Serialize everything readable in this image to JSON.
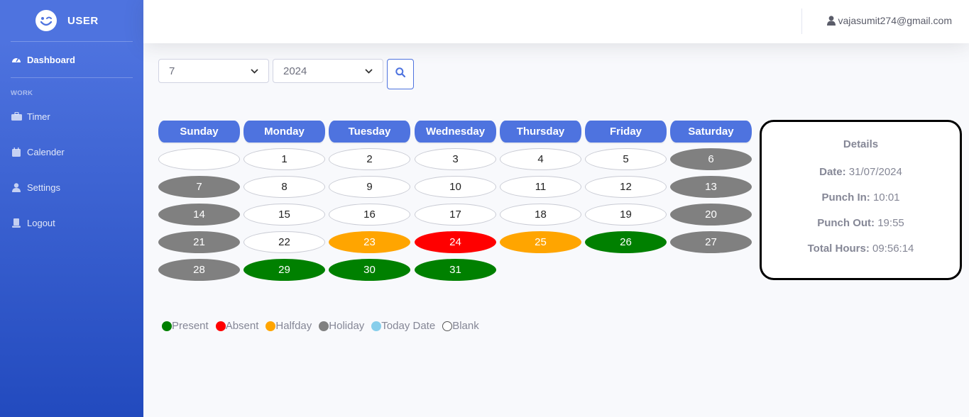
{
  "brand": {
    "name": "USER",
    "icon": "winking-face-icon"
  },
  "sidebar": {
    "active": {
      "label": "Dashboard",
      "icon": "gauge-icon"
    },
    "heading": "WORK",
    "items": [
      {
        "label": "Timer",
        "icon": "toolbox-icon"
      },
      {
        "label": "Calender",
        "icon": "calendar-icon"
      },
      {
        "label": "Settings",
        "icon": "user-icon"
      },
      {
        "label": "Logout",
        "icon": "logout-icon"
      }
    ]
  },
  "topbar": {
    "user_email": "vajasumit274@gmail.com",
    "user_icon": "user-icon"
  },
  "filters": {
    "month": "7",
    "year": "2024",
    "search_icon": "search-icon"
  },
  "calendar": {
    "weekdays": [
      "Sunday",
      "Monday",
      "Tuesday",
      "Wednesday",
      "Thursday",
      "Friday",
      "Saturday"
    ],
    "start_offset": 1,
    "days": [
      {
        "d": "1",
        "s": "blank"
      },
      {
        "d": "2",
        "s": "blank"
      },
      {
        "d": "3",
        "s": "blank"
      },
      {
        "d": "4",
        "s": "blank"
      },
      {
        "d": "5",
        "s": "blank"
      },
      {
        "d": "6",
        "s": "holiday"
      },
      {
        "d": "7",
        "s": "holiday"
      },
      {
        "d": "8",
        "s": "blank"
      },
      {
        "d": "9",
        "s": "blank"
      },
      {
        "d": "10",
        "s": "blank"
      },
      {
        "d": "11",
        "s": "blank"
      },
      {
        "d": "12",
        "s": "blank"
      },
      {
        "d": "13",
        "s": "holiday"
      },
      {
        "d": "14",
        "s": "holiday"
      },
      {
        "d": "15",
        "s": "blank"
      },
      {
        "d": "16",
        "s": "blank"
      },
      {
        "d": "17",
        "s": "blank"
      },
      {
        "d": "18",
        "s": "blank"
      },
      {
        "d": "19",
        "s": "blank"
      },
      {
        "d": "20",
        "s": "holiday"
      },
      {
        "d": "21",
        "s": "holiday"
      },
      {
        "d": "22",
        "s": "blank"
      },
      {
        "d": "23",
        "s": "halfday"
      },
      {
        "d": "24",
        "s": "absent"
      },
      {
        "d": "25",
        "s": "halfday"
      },
      {
        "d": "26",
        "s": "present"
      },
      {
        "d": "27",
        "s": "holiday"
      },
      {
        "d": "28",
        "s": "holiday"
      },
      {
        "d": "29",
        "s": "present"
      },
      {
        "d": "30",
        "s": "present"
      },
      {
        "d": "31",
        "s": "present"
      }
    ]
  },
  "details": {
    "title": "Details",
    "date_label": "Date:",
    "date_value": "31/07/2024",
    "punch_in_label": "Punch In:",
    "punch_in_value": "10:01",
    "punch_out_label": "Punch Out:",
    "punch_out_value": "19:55",
    "total_label": "Total Hours:",
    "total_value": "09:56:14"
  },
  "legend": [
    {
      "label": "Present",
      "color": "#008000"
    },
    {
      "label": "Absent",
      "color": "#ff0000"
    },
    {
      "label": "Halfday",
      "color": "#ffa500"
    },
    {
      "label": "Holiday",
      "color": "#808080"
    },
    {
      "label": "Today Date",
      "color": "#87ceeb"
    },
    {
      "label": "Blank",
      "color": "#ffffff"
    }
  ]
}
